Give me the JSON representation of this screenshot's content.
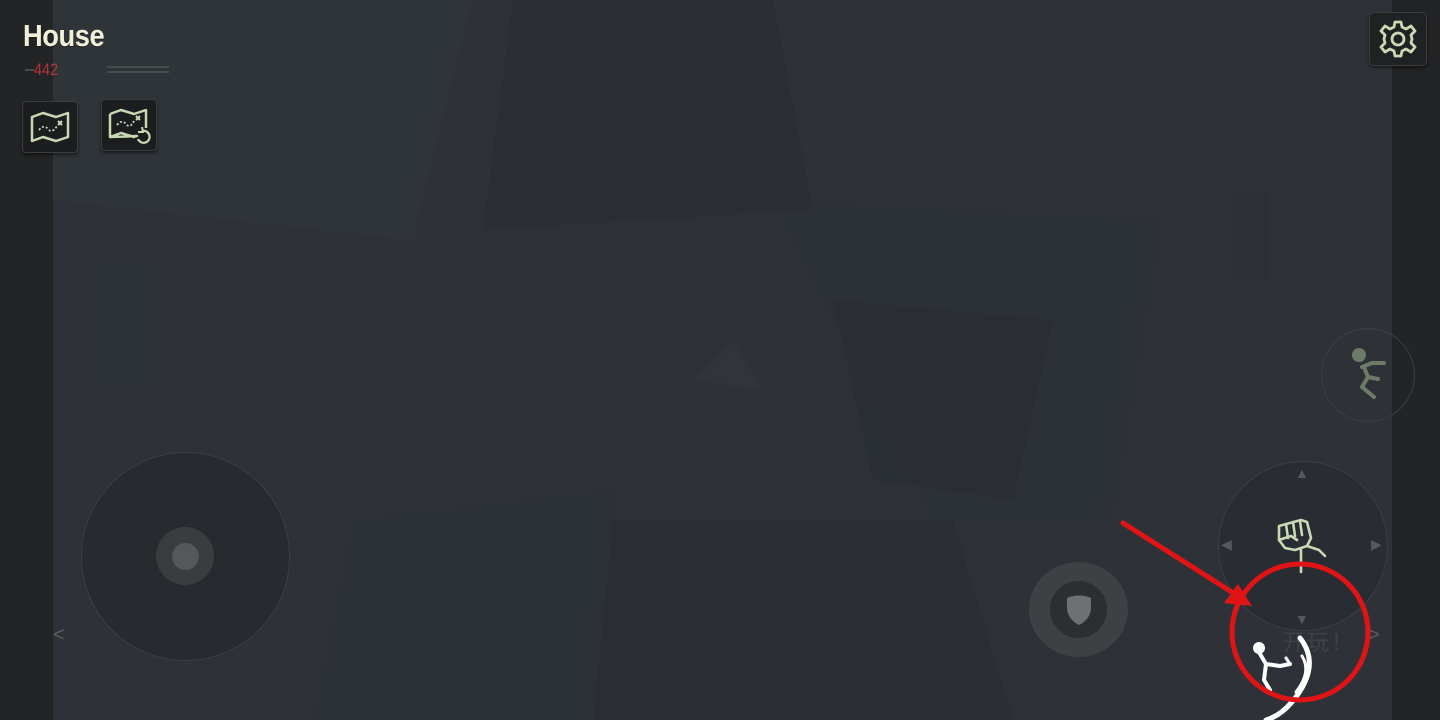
{
  "hud": {
    "location_title": "House",
    "score": "442"
  },
  "buttons": {
    "map_icon": "map-icon",
    "map_refresh_icon": "map-refresh-icon",
    "settings_icon": "gear-icon",
    "shield_icon": "shield-icon",
    "jump_icon": "stickman-jump-icon",
    "attack_icon": "fist-icon",
    "kick_icon": "stickman-kick-icon"
  },
  "controls": {
    "left_arrow": "<",
    "right_arrow": ">",
    "start_hint": "开玩！"
  },
  "annotation": {
    "color": "#e01414"
  },
  "colors": {
    "hud_title": "#f2f0d8",
    "score": "#b7343a",
    "icon_green": "#c9d9b3"
  }
}
